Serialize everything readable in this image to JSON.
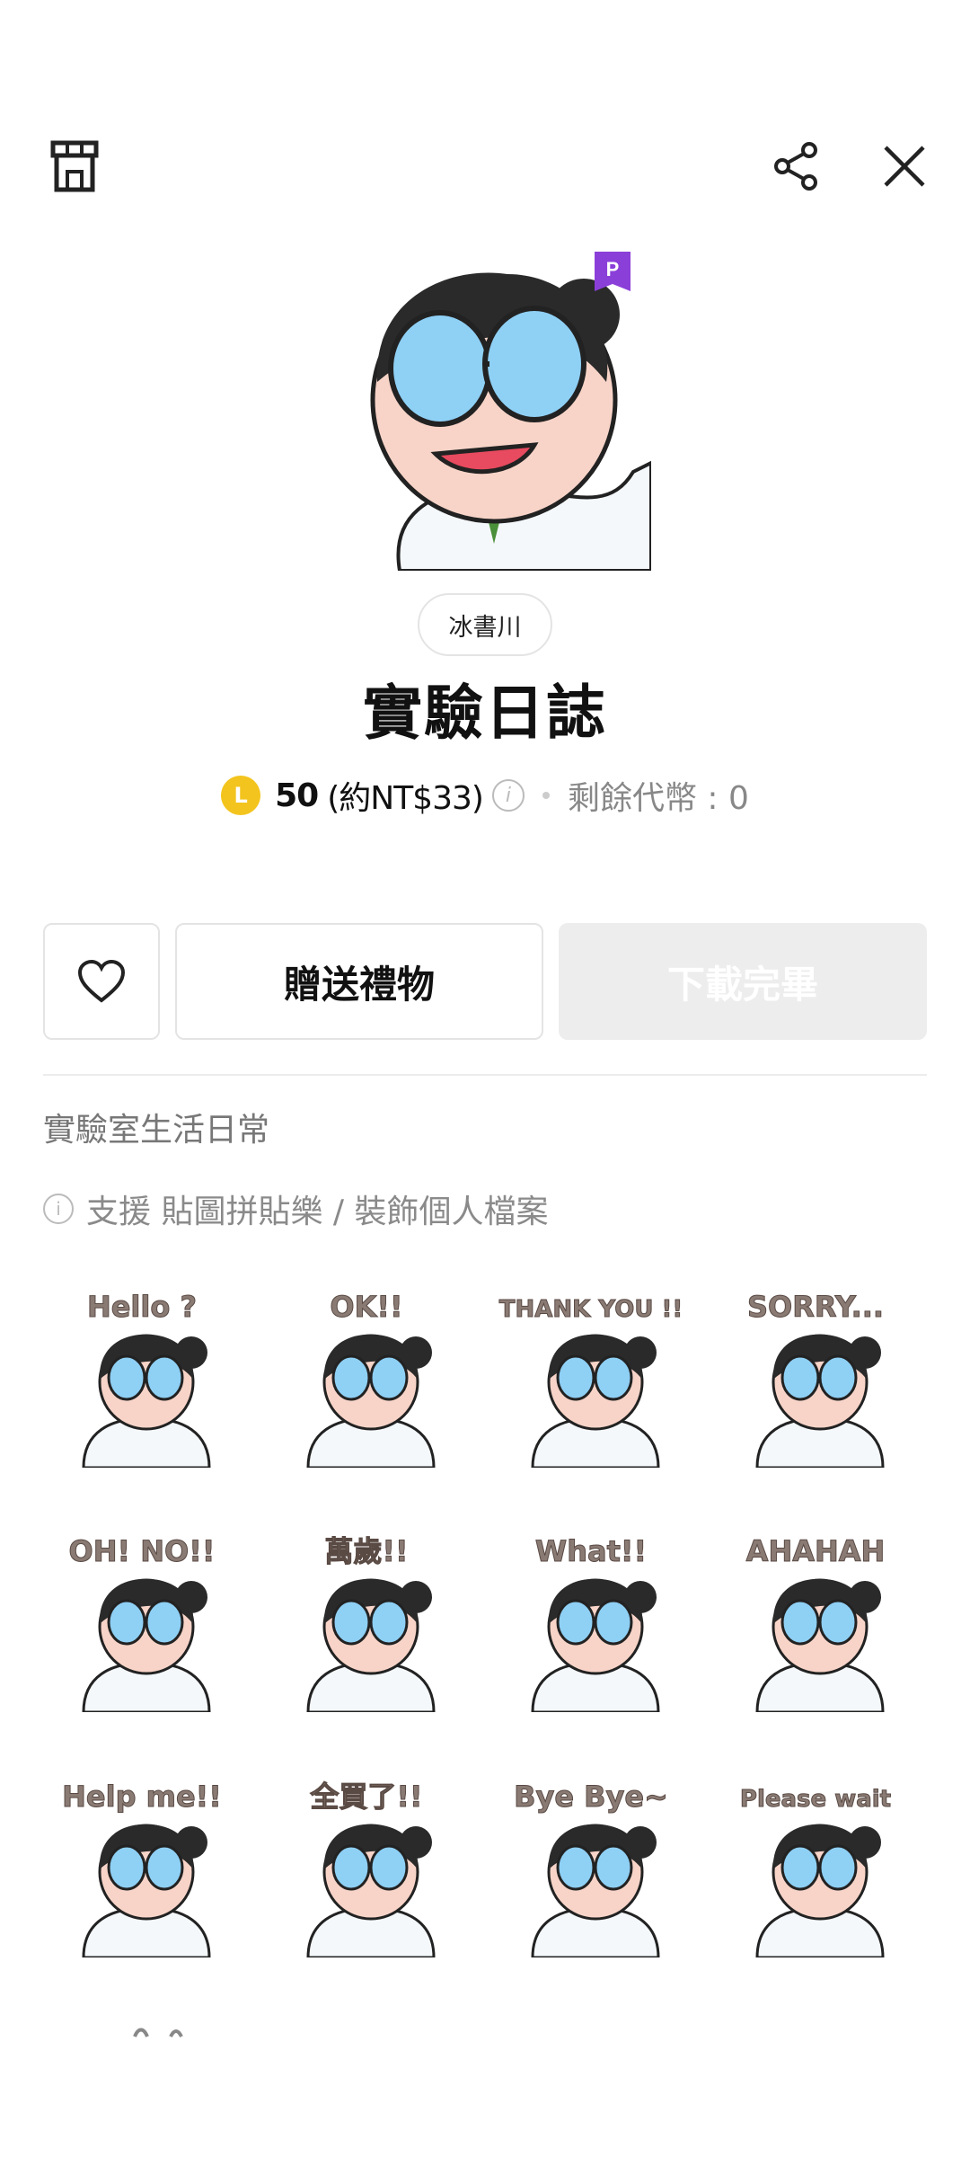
{
  "header": {
    "icons": [
      "shop-icon",
      "share-icon",
      "close-icon"
    ]
  },
  "product": {
    "author": "冰書川",
    "title": "實驗日誌",
    "premium_badge": "P",
    "price_coins": "50",
    "price_note": "(約NT$33)",
    "remaining_label": "剩餘代幣 : 0",
    "coin_letter": "L",
    "description": "實驗室生活日常",
    "support_text": "支援 貼圖拼貼樂 / 裝飾個人檔案"
  },
  "actions": {
    "gift_label": "贈送禮物",
    "download_label": "下載完畢"
  },
  "stickers": [
    {
      "caption": "Hello ?"
    },
    {
      "caption": "OK!!"
    },
    {
      "caption": "THANK YOU !!"
    },
    {
      "caption": "SORRY..."
    },
    {
      "caption": "OH! NO!!"
    },
    {
      "caption": "萬歲!!"
    },
    {
      "caption": "What!!"
    },
    {
      "caption": "AHAHAH"
    },
    {
      "caption": "Help me!!"
    },
    {
      "caption": "全買了!!"
    },
    {
      "caption": "Bye Bye~"
    },
    {
      "caption": "Please wait"
    }
  ],
  "colors": {
    "coin": "#f3c41e",
    "premium_badge": "#8b3fd9",
    "lens": "#8fd0f5",
    "disabled_button": "#ededed"
  }
}
